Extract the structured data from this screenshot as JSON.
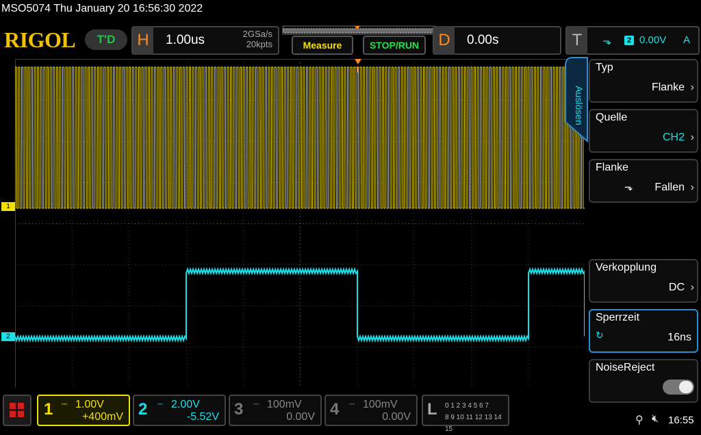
{
  "device_title": "MSO5074  Thu January 20 16:56:30 2022",
  "logo": "RIGOL",
  "run_status": "T'D",
  "horizontal": {
    "letter": "H",
    "timebase": "1.00us",
    "sample_rate": "2GSa/s",
    "memory": "20kpts"
  },
  "buttons": {
    "measure": "Measure",
    "stop_run": "STOP/RUN"
  },
  "delay": {
    "letter": "D",
    "value": "0.00s"
  },
  "trigger": {
    "letter": "T",
    "source": "2",
    "level": "0.00V",
    "mode": "A",
    "edge_icon": "falling-edge-icon"
  },
  "side_menu": {
    "tab_label": "Auslösen",
    "items": [
      {
        "label": "Typ",
        "value": "Flanke"
      },
      {
        "label": "Quelle",
        "value": "CH2"
      },
      {
        "label": "Flanke",
        "value": "Fallen"
      },
      {
        "label": "Verkopplung",
        "value": "DC"
      },
      {
        "label": "Sperrzeit",
        "value": "16ns"
      },
      {
        "label": "NoiseReject",
        "value": ""
      }
    ]
  },
  "channels": [
    {
      "num": "1",
      "scale": "1.00V",
      "offset": "+400mV",
      "color": "#f2e000",
      "active": true
    },
    {
      "num": "2",
      "scale": "2.00V",
      "offset": "-5.52V",
      "color": "#19e0e8",
      "active": true
    },
    {
      "num": "3",
      "scale": "100mV",
      "offset": "0.00V",
      "color": "#777777",
      "active": false
    },
    {
      "num": "4",
      "scale": "100mV",
      "offset": "0.00V",
      "color": "#777777",
      "active": false
    }
  ],
  "logic": {
    "letter": "L",
    "row1": "0 1 2 3   4 5 6 7",
    "row2": "8 9 10 11 12 13 14 15"
  },
  "markers": {
    "ch1": "1",
    "ch2": "2"
  },
  "status_bar": {
    "time": "16:55"
  },
  "colors": {
    "ch1": "#f2e000",
    "ch2": "#19e0e8",
    "accent": "#2a8fd0",
    "horizontal": "#ff8a1d"
  },
  "waveforms": {
    "ch1": {
      "type": "square",
      "periods_visible": 180
    },
    "ch2": {
      "type": "square",
      "high_windows": [
        [
          0.3,
          0.6
        ],
        [
          0.9,
          1.0
        ]
      ]
    }
  }
}
